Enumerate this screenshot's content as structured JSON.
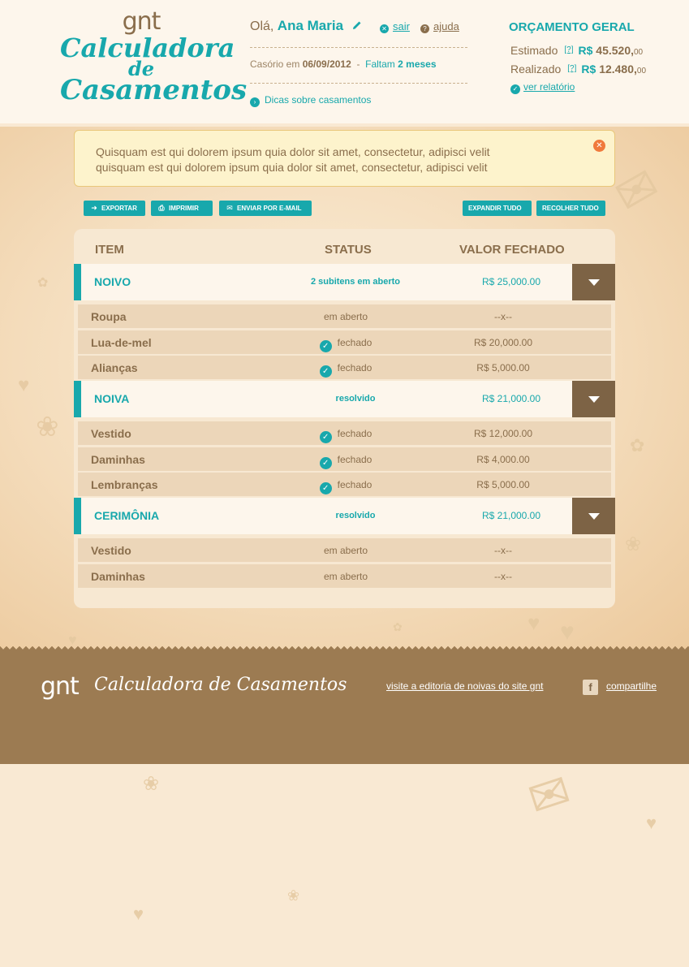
{
  "logo": {
    "brand": "gnt",
    "line1": "Calculadora",
    "line2": "de",
    "line3": "Casamentos"
  },
  "header": {
    "greeting": "Olá,",
    "user_name": "Ana Maria",
    "logout_label": "sair",
    "help_label": "ajuda",
    "wedding_prefix": "Casório em",
    "wedding_date": "06/09/2012",
    "wedding_sep": "-",
    "remaining_prefix": "Faltam",
    "remaining_value": "2 meses",
    "tips_label": "Dicas sobre casamentos"
  },
  "budget": {
    "title": "ORÇAMENTO GERAL",
    "estimated_label": "Estimado",
    "estimated_help": "[?]",
    "estimated_currency": "R$",
    "estimated_value": "45.520,",
    "estimated_cents": "00",
    "realized_label": "Realizado",
    "realized_help": "[?]",
    "realized_currency": "R$",
    "realized_value": "12.480,",
    "realized_cents": "00",
    "report_label": "ver relatório"
  },
  "alert": {
    "line1": "Quisquam est qui dolorem ipsum quia dolor sit amet, consectetur, adipisci velit",
    "line2": "quisquam est qui dolorem ipsum quia dolor sit amet, consectetur, adipisci velit"
  },
  "toolbar": {
    "export_label": "EXPORTAR",
    "print_label": "IMPRIMIR",
    "email_label": "ENVIAR POR E-MAIL",
    "expand_label": "EXPANDIR TUDO",
    "collapse_label": "RECOLHER TUDO"
  },
  "table": {
    "headers": {
      "item": "ITEM",
      "status": "STATUS",
      "value": "VALOR FECHADO"
    },
    "categories": [
      {
        "name": "NOIVO",
        "status": "2 subitens em aberto",
        "value": "R$ 25,000.00",
        "items": [
          {
            "name": "Roupa",
            "status": "em aberto",
            "closed": false,
            "value": "--x--"
          },
          {
            "name": "Lua-de-mel",
            "status": "fechado",
            "closed": true,
            "value": "R$ 20,000.00"
          },
          {
            "name": "Alianças",
            "status": "fechado",
            "closed": true,
            "value": "R$ 5,000.00"
          }
        ]
      },
      {
        "name": "NOIVA",
        "status": "resolvido",
        "value": "R$ 21,000.00",
        "items": [
          {
            "name": "Vestido",
            "status": "fechado",
            "closed": true,
            "value": "R$ 12,000.00"
          },
          {
            "name": "Daminhas",
            "status": "fechado",
            "closed": true,
            "value": "R$ 4,000.00"
          },
          {
            "name": "Lembranças",
            "status": "fechado",
            "closed": true,
            "value": "R$ 5,000.00"
          }
        ]
      },
      {
        "name": "CERIMÔNIA",
        "status": "resolvido",
        "value": "R$ 21,000.00",
        "items": [
          {
            "name": "Vestido",
            "status": "em aberto",
            "closed": false,
            "value": "--x--"
          },
          {
            "name": "Daminhas",
            "status": "em aberto",
            "closed": false,
            "value": "--x--"
          }
        ]
      }
    ]
  },
  "footer": {
    "brand": "gnt",
    "title": "Calculadora de Casamentos",
    "editorial_link": "visite a editoria de noivas do site gnt",
    "share_label": "compartilhe"
  },
  "icons": {
    "edit": "pencil-icon",
    "logout": "close-circle-icon",
    "help": "question-icon",
    "tips": "chevron-right-circle-icon",
    "report": "check-circle-icon",
    "export": "arrow-right-icon",
    "print": "printer-icon",
    "email": "envelope-icon",
    "closed": "check-circle-icon",
    "toggle": "chevron-down-icon",
    "facebook": "facebook-icon"
  },
  "colors": {
    "accent": "#18a8ac",
    "brown": "#8a6e4c",
    "footer": "#9c7b52",
    "alert_close": "#f07a3c"
  }
}
